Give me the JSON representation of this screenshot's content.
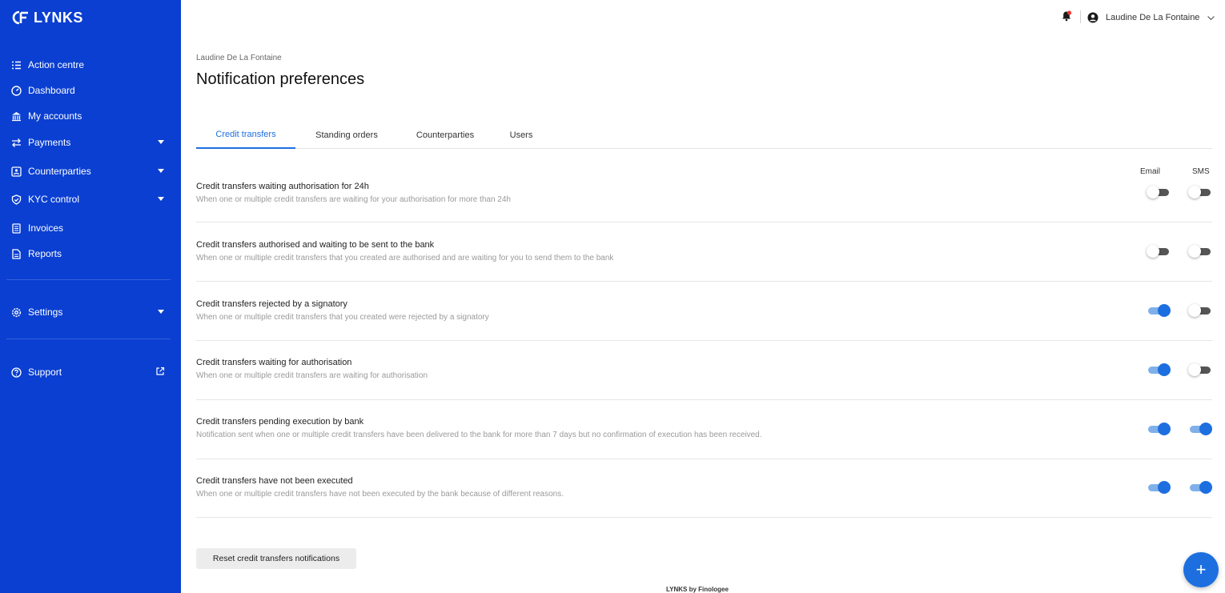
{
  "app": {
    "logo_text": "LYNKS"
  },
  "sidebar": {
    "items": [
      {
        "label": "Action centre",
        "icon": "list-checks-icon"
      },
      {
        "label": "Dashboard",
        "icon": "gauge-icon"
      },
      {
        "label": "My accounts",
        "icon": "bank-icon"
      },
      {
        "label": "Payments",
        "icon": "transfer-arrows-icon",
        "has_caret": true
      },
      {
        "label": "Counterparties",
        "icon": "contact-card-icon",
        "has_caret": true
      },
      {
        "label": "KYC control",
        "icon": "shield-check-icon",
        "has_caret": true
      },
      {
        "label": "Invoices",
        "icon": "invoice-icon"
      },
      {
        "label": "Reports",
        "icon": "document-icon"
      },
      {
        "label": "Settings",
        "icon": "gear-icon",
        "has_caret": true
      },
      {
        "label": "Support",
        "icon": "help-circle-icon",
        "external": true
      }
    ]
  },
  "header": {
    "user_name": "Laudine De La Fontaine",
    "bell_color": "#e53935"
  },
  "page": {
    "breadcrumb": "Laudine De La Fontaine",
    "title": "Notification preferences"
  },
  "tabs": [
    {
      "label": "Credit transfers",
      "active": true
    },
    {
      "label": "Standing orders",
      "active": false
    },
    {
      "label": "Counterparties",
      "active": false
    },
    {
      "label": "Users",
      "active": false
    }
  ],
  "columns": {
    "email": "Email",
    "sms": "SMS"
  },
  "rows": [
    {
      "title": "Credit transfers waiting authorisation for 24h",
      "description": "When one or multiple credit transfers are waiting for your authorisation for more than 24h",
      "email": false,
      "sms": false
    },
    {
      "title": "Credit transfers authorised and waiting to be sent to the bank",
      "description": "When one or multiple credit transfers that you created are authorised and are waiting for you to send them to the bank",
      "email": false,
      "sms": false
    },
    {
      "title": "Credit transfers rejected by a signatory",
      "description": "When one or multiple credit transfers that you created were rejected by a signatory",
      "email": true,
      "sms": false
    },
    {
      "title": "Credit transfers waiting for authorisation",
      "description": "When one or multiple credit transfers are waiting for authorisation",
      "email": true,
      "sms": false
    },
    {
      "title": "Credit transfers pending execution by bank",
      "description": "Notification sent when one or multiple credit transfers have been delivered to the bank for more than 7 days but no confirmation of execution has been received.",
      "email": true,
      "sms": true
    },
    {
      "title": "Credit transfers have not been executed",
      "description": "When one or multiple credit transfers have not been executed by the bank because of different reasons.",
      "email": true,
      "sms": true
    }
  ],
  "actions": {
    "reset_label": "Reset credit transfers notifications",
    "fab_label": "+"
  },
  "footer": {
    "text": "LYNKS by Finologee"
  },
  "colors": {
    "sidebar_bg": "#0a3fd1",
    "accent": "#1d6fe0"
  }
}
